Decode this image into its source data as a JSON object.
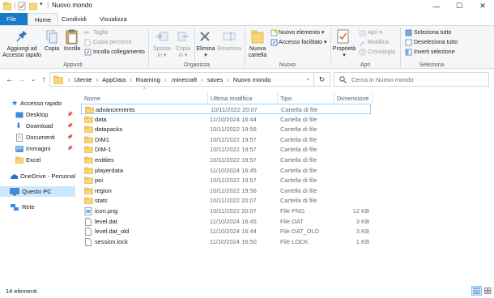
{
  "window": {
    "title": "Nuovo mondo",
    "controls": {
      "minimize": "—",
      "maximize": "☐",
      "close": "✕"
    }
  },
  "ribbon_tabs": [
    {
      "label": "File",
      "active": false
    },
    {
      "label": "Home",
      "active": true
    },
    {
      "label": "Condividi",
      "active": false
    },
    {
      "label": "Visualizza",
      "active": false
    }
  ],
  "ribbon": {
    "clipboard": {
      "pin_label_1": "Aggiungi ad",
      "pin_label_2": "Accesso rapido",
      "copy_label": "Copia",
      "paste_label": "Incolla",
      "cut_label": "Taglia",
      "copy_path_label": "Copia percorso",
      "paste_shortcut_label": "Incolla collegamento",
      "group_label": "Appunti"
    },
    "organize": {
      "move_label_1": "Sposta",
      "move_label_2": "in ▾",
      "copyto_label_1": "Copia",
      "copyto_label_2": "in ▾",
      "delete_label_1": "Elimina",
      "delete_label_2": "▾",
      "rename_label": "Rinomina",
      "group_label": "Organizza"
    },
    "new": {
      "new_folder_label_1": "Nuova",
      "new_folder_label_2": "cartella",
      "new_item_label": "Nuovo elemento ▾",
      "easy_access_label": "Accesso facilitato ▾",
      "group_label": "Nuovo"
    },
    "open": {
      "properties_label_1": "Proprietà",
      "properties_label_2": "▾",
      "open_label": "Apri ▾",
      "edit_label": "Modifica",
      "history_label": "Cronologia",
      "group_label": "Apri"
    },
    "select": {
      "select_all_label": "Seleziona tutto",
      "select_none_label": "Deseleziona tutto",
      "invert_label": "Inverti selezione",
      "group_label": "Seleziona"
    }
  },
  "address": {
    "crumbs": [
      "Utente",
      "AppData",
      "Roaming",
      ".minecraft",
      "saves",
      "Nuovo mondo"
    ],
    "search_placeholder": "Cerca in Nuovo mondo"
  },
  "navpane": [
    {
      "label": "Accesso rapido",
      "icon": "star-icon",
      "pinned": false,
      "selected": false
    },
    {
      "label": "Desktop",
      "icon": "desktop-icon",
      "pinned": true,
      "selected": false
    },
    {
      "label": "Download",
      "icon": "download-icon",
      "pinned": true,
      "selected": false
    },
    {
      "label": "Documenti",
      "icon": "documents-icon",
      "pinned": true,
      "selected": false
    },
    {
      "label": "Immagini",
      "icon": "pictures-icon",
      "pinned": true,
      "selected": false
    },
    {
      "label": "Excel",
      "icon": "folder-icon",
      "pinned": false,
      "selected": false
    },
    {
      "label": "OneDrive - Personal",
      "icon": "cloud-icon",
      "pinned": false,
      "selected": false
    },
    {
      "label": "Questo PC",
      "icon": "pc-icon",
      "pinned": false,
      "selected": true
    },
    {
      "label": "Rete",
      "icon": "network-icon",
      "pinned": false,
      "selected": false
    }
  ],
  "columns": {
    "name": "Nome",
    "modified": "Ultima modifica",
    "type": "Tipo",
    "size": "Dimensione"
  },
  "files": [
    {
      "name": "advancements",
      "modified": "10/11/2022 20:07",
      "type": "Cartella di file",
      "size": "",
      "icon": "folder-icon"
    },
    {
      "name": "data",
      "modified": "11/10/2024 16:44",
      "type": "Cartella di file",
      "size": "",
      "icon": "folder-icon"
    },
    {
      "name": "datapacks",
      "modified": "10/11/2022 19:56",
      "type": "Cartella di file",
      "size": "",
      "icon": "folder-icon"
    },
    {
      "name": "DIM1",
      "modified": "10/11/2022 19:57",
      "type": "Cartella di file",
      "size": "",
      "icon": "folder-icon"
    },
    {
      "name": "DIM-1",
      "modified": "10/11/2022 19:57",
      "type": "Cartella di file",
      "size": "",
      "icon": "folder-icon"
    },
    {
      "name": "entities",
      "modified": "10/11/2022 19:57",
      "type": "Cartella di file",
      "size": "",
      "icon": "folder-icon"
    },
    {
      "name": "playerdata",
      "modified": "11/10/2024 16:45",
      "type": "Cartella di file",
      "size": "",
      "icon": "folder-icon"
    },
    {
      "name": "poi",
      "modified": "10/11/2022 19:57",
      "type": "Cartella di file",
      "size": "",
      "icon": "folder-icon"
    },
    {
      "name": "region",
      "modified": "10/11/2022 19:56",
      "type": "Cartella di file",
      "size": "",
      "icon": "folder-icon"
    },
    {
      "name": "stats",
      "modified": "10/11/2022 20:07",
      "type": "Cartella di file",
      "size": "",
      "icon": "folder-icon"
    },
    {
      "name": "icon.png",
      "modified": "10/11/2022 20:07",
      "type": "File PNG",
      "size": "12 KB",
      "icon": "image-file-icon"
    },
    {
      "name": "level.dat",
      "modified": "11/10/2024 16:45",
      "type": "File DAT",
      "size": "3 KB",
      "icon": "file-icon"
    },
    {
      "name": "level.dat_old",
      "modified": "11/10/2024 16:44",
      "type": "File DAT_OLD",
      "size": "3 KB",
      "icon": "file-icon"
    },
    {
      "name": "session.lock",
      "modified": "11/10/2024 16:50",
      "type": "File LOCK",
      "size": "1 KB",
      "icon": "file-icon"
    }
  ],
  "status": {
    "item_count": "14 elementi"
  },
  "colors": {
    "accent": "#0078d7",
    "folder": "#f8d775",
    "selected_nav": "#cce8ff",
    "ribbon_bg": "#f5f6f7"
  }
}
